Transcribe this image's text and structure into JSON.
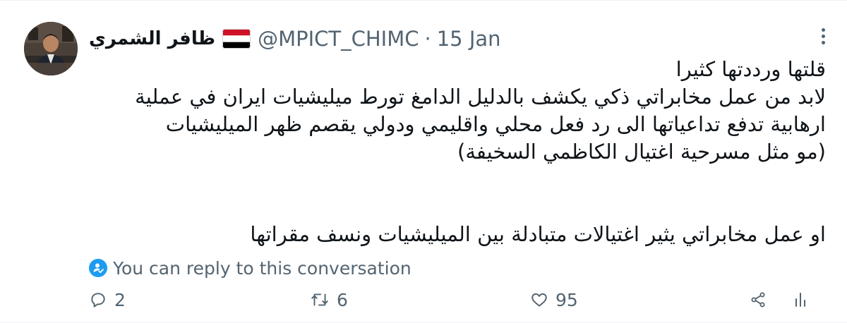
{
  "tweet": {
    "author": {
      "display_name": "ظافر الشمري",
      "flag_icon": "yemen-flag-icon",
      "flag_colors": [
        "#ce1126",
        "#ffffff",
        "#000000"
      ],
      "handle": "@MPICT_CHIMC",
      "separator": "·",
      "date": "15 Jan"
    },
    "more_icon": "more-horizontal-icon",
    "text_lines": [
      "قلتها ورددتها كثيرا",
      "لابد من عمل مخابراتي ذكي يكشف بالدليل الدامغ تورط ميليشيات ايران في عملية",
      "ارهابية تدفع تداعياتها الى رد فعل محلي واقليمي ودولي يقصم ظهر الميليشيات",
      "(مو مثل مسرحية اغتيال الكاظمي السخيفة)",
      "",
      "او عمل مخابراتي يثير اغتيالات متبادلة بين الميليشيات ونسف مقراتها"
    ],
    "reply_restriction": {
      "icon": "person-check-icon",
      "text": "You can reply to this conversation"
    },
    "actions": {
      "reply": {
        "icon": "reply-icon",
        "count": "2"
      },
      "retweet": {
        "icon": "retweet-icon",
        "count": "6"
      },
      "like": {
        "icon": "heart-icon",
        "count": "95"
      },
      "share": {
        "icon": "share-icon"
      },
      "analytics": {
        "icon": "analytics-icon"
      }
    },
    "colors": {
      "text": "#0f1419",
      "secondary": "#536471",
      "accent": "#1d9bf0",
      "border": "#eff3f4"
    }
  }
}
